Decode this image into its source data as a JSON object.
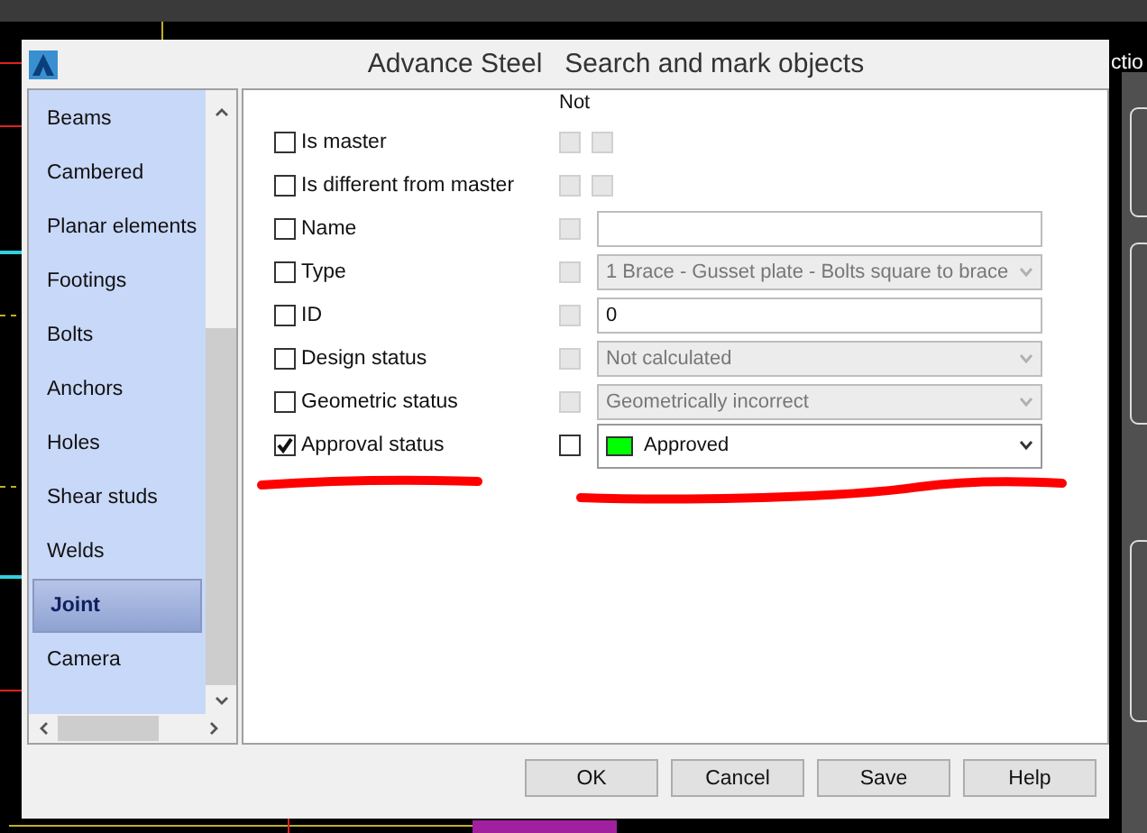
{
  "background_text": "ctio",
  "window": {
    "title": "Advance Steel   Search and mark objects"
  },
  "sidebar": {
    "items": [
      {
        "label": "Beams",
        "selected": false
      },
      {
        "label": "Cambered",
        "selected": false
      },
      {
        "label": "Planar elements",
        "selected": false
      },
      {
        "label": "Footings",
        "selected": false
      },
      {
        "label": "Bolts",
        "selected": false
      },
      {
        "label": "Anchors",
        "selected": false
      },
      {
        "label": "Holes",
        "selected": false
      },
      {
        "label": "Shear studs",
        "selected": false
      },
      {
        "label": "Welds",
        "selected": false
      },
      {
        "label": "Joint",
        "selected": true
      },
      {
        "label": "Camera",
        "selected": false
      }
    ]
  },
  "not_header": "Not",
  "criteria": [
    {
      "kind": "pair",
      "label": "Is master",
      "checked": false,
      "not": [
        {
          "checked": false,
          "disabled": true
        },
        {
          "checked": false,
          "disabled": true
        }
      ]
    },
    {
      "kind": "pair",
      "label": "Is different from master",
      "checked": false,
      "not": [
        {
          "checked": false,
          "disabled": true
        },
        {
          "checked": false,
          "disabled": true
        }
      ]
    },
    {
      "kind": "text",
      "label": "Name",
      "checked": false,
      "not": [
        {
          "checked": false,
          "disabled": true
        }
      ],
      "field": {
        "disabled": false
      }
    },
    {
      "kind": "combo",
      "label": "Type",
      "checked": false,
      "not": [
        {
          "checked": false,
          "disabled": true
        }
      ],
      "field": {
        "value": "1 Brace -  Gusset plate - Bolts square to brace",
        "disabled": true
      }
    },
    {
      "kind": "text",
      "label": "ID",
      "checked": false,
      "not": [
        {
          "checked": false,
          "disabled": true
        }
      ],
      "field": {
        "value": "0",
        "disabled": false
      }
    },
    {
      "kind": "combo",
      "label": "Design status",
      "checked": false,
      "not": [
        {
          "checked": false,
          "disabled": true
        }
      ],
      "field": {
        "value": "Not calculated",
        "disabled": true
      }
    },
    {
      "kind": "combo",
      "label": "Geometric status",
      "checked": false,
      "not": [
        {
          "checked": false,
          "disabled": true
        }
      ],
      "field": {
        "value": "Geometrically incorrect",
        "disabled": true
      }
    },
    {
      "kind": "combo",
      "label": "Approval status",
      "checked": true,
      "not": [
        {
          "checked": false,
          "disabled": false
        }
      ],
      "field": {
        "value": "Approved",
        "disabled": false,
        "color": "#00ff00"
      }
    }
  ],
  "buttons": [
    "OK",
    "Cancel",
    "Save",
    "Help"
  ]
}
